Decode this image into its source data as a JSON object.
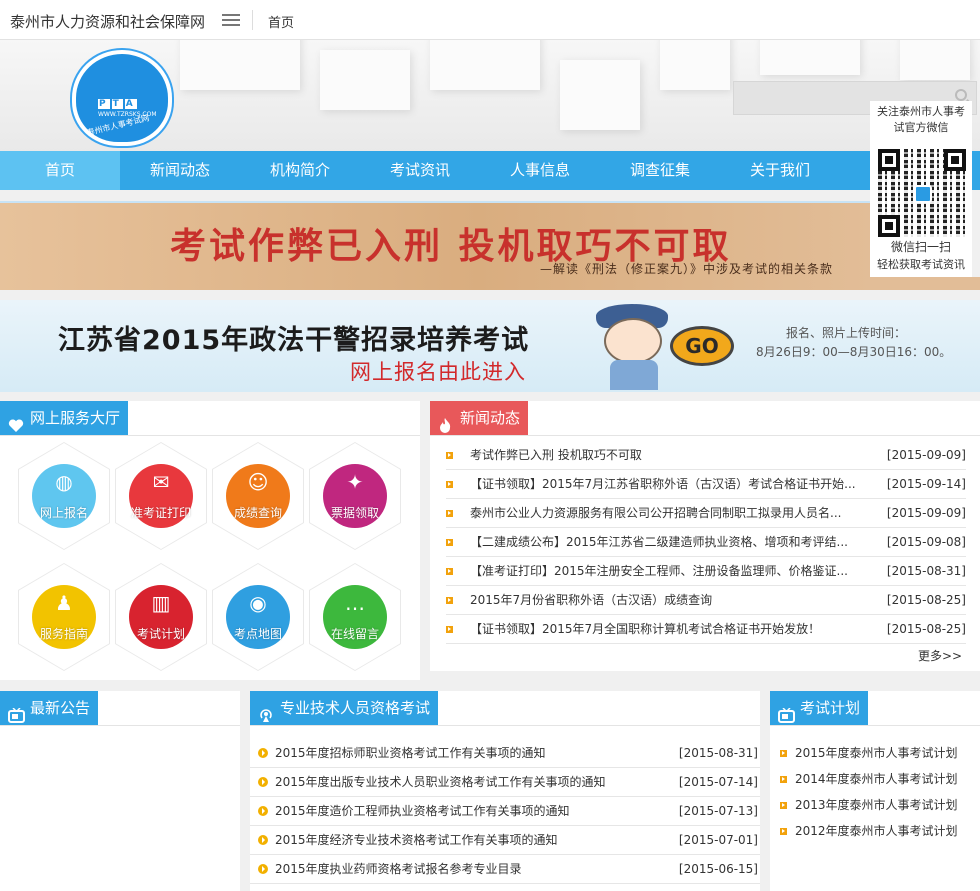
{
  "topbar": {
    "site_name": "泰州市人力资源和社会保障网",
    "home": "首页"
  },
  "logo": {
    "letters": [
      "P",
      "T",
      "A"
    ],
    "url_text": "WWW.TZRSKS.COM",
    "text": "泰州市人事考试网"
  },
  "nav": [
    "首页",
    "新闻动态",
    "机构简介",
    "考试资讯",
    "人事信息",
    "调查征集",
    "关于我们"
  ],
  "wechat": {
    "line1": "关注泰州市人事考",
    "line2": "试官方微信",
    "line3": "微信扫一扫",
    "line4": "轻松获取考试资讯"
  },
  "banner1": {
    "main": "考试作弊已入刑  投机取巧不可取",
    "sub": "—解读《刑法（修正案九）》中涉及考试的相关条款"
  },
  "banner2": {
    "title": "江苏省2015年政法干警招录培养考试",
    "enter": "网上报名由此进入",
    "info1": "报名、照片上传时间：",
    "info2": "8月26日9：00—8月30日16：00。",
    "go": "GO"
  },
  "service": {
    "title": "网上服务大厅",
    "items": [
      {
        "label": "网上报名",
        "color": "#5fc6ef",
        "glyph": "◍"
      },
      {
        "label": "准考证打印",
        "color": "#e8383d",
        "glyph": "✉"
      },
      {
        "label": "成绩查询",
        "color": "#f07a1a",
        "glyph": "☺"
      },
      {
        "label": "票据领取",
        "color": "#c0277f",
        "glyph": "✦"
      },
      {
        "label": "服务指南",
        "color": "#f2c300",
        "glyph": "♟"
      },
      {
        "label": "考试计划",
        "color": "#d8232f",
        "glyph": "▥"
      },
      {
        "label": "考点地图",
        "color": "#2f9fe0",
        "glyph": "◉"
      },
      {
        "label": "在线留言",
        "color": "#3db83d",
        "glyph": "…"
      }
    ]
  },
  "news": {
    "title": "新闻动态",
    "more": "更多>>",
    "rows": [
      {
        "title": "考试作弊已入刑 投机取巧不可取",
        "date": "[2015-09-09]"
      },
      {
        "title": "【证书领取】2015年7月江苏省职称外语（古汉语）考试合格证书开始...",
        "date": "[2015-09-14]"
      },
      {
        "title": "泰州市公业人力资源服务有限公司公开招聘合同制职工拟录用人员名...",
        "date": "[2015-09-09]"
      },
      {
        "title": "【二建成绩公布】2015年江苏省二级建造师执业资格、增项和考评结...",
        "date": "[2015-09-08]"
      },
      {
        "title": "【准考证打印】2015年注册安全工程师、注册设备监理师、价格鉴证...",
        "date": "[2015-08-31]"
      },
      {
        "title": "2015年7月份省职称外语（古汉语）成绩查询",
        "date": "[2015-08-25]"
      },
      {
        "title": "【证书领取】2015年7月全国职称计算机考试合格证书开始发放！",
        "date": "[2015-08-25]"
      }
    ]
  },
  "notice": {
    "title": "最新公告"
  },
  "qualification": {
    "title": "专业技术人员资格考试",
    "rows": [
      {
        "title": "2015年度招标师职业资格考试工作有关事项的通知",
        "date": "[2015-08-31]"
      },
      {
        "title": "2015年度出版专业技术人员职业资格考试工作有关事项的通知",
        "date": "[2015-07-14]"
      },
      {
        "title": "2015年度造价工程师执业资格考试工作有关事项的通知",
        "date": "[2015-07-13]"
      },
      {
        "title": "2015年度经济专业技术资格考试工作有关事项的通知",
        "date": "[2015-07-01]"
      },
      {
        "title": "2015年度执业药师资格考试报名参考专业目录",
        "date": "[2015-06-15]"
      }
    ]
  },
  "plan": {
    "title": "考试计划",
    "rows": [
      "2015年度泰州市人事考试计划",
      "2014年度泰州市人事考试计划",
      "2013年度泰州市人事考试计划",
      "2012年度泰州市人事考试计划"
    ]
  },
  "colors": {
    "nav": "#32a6e6",
    "nav_active": "#5dc2f2",
    "tab_blue": "#2fa2e3",
    "tab_red": "#e8585a",
    "date_bullet": "#f2a20c"
  }
}
